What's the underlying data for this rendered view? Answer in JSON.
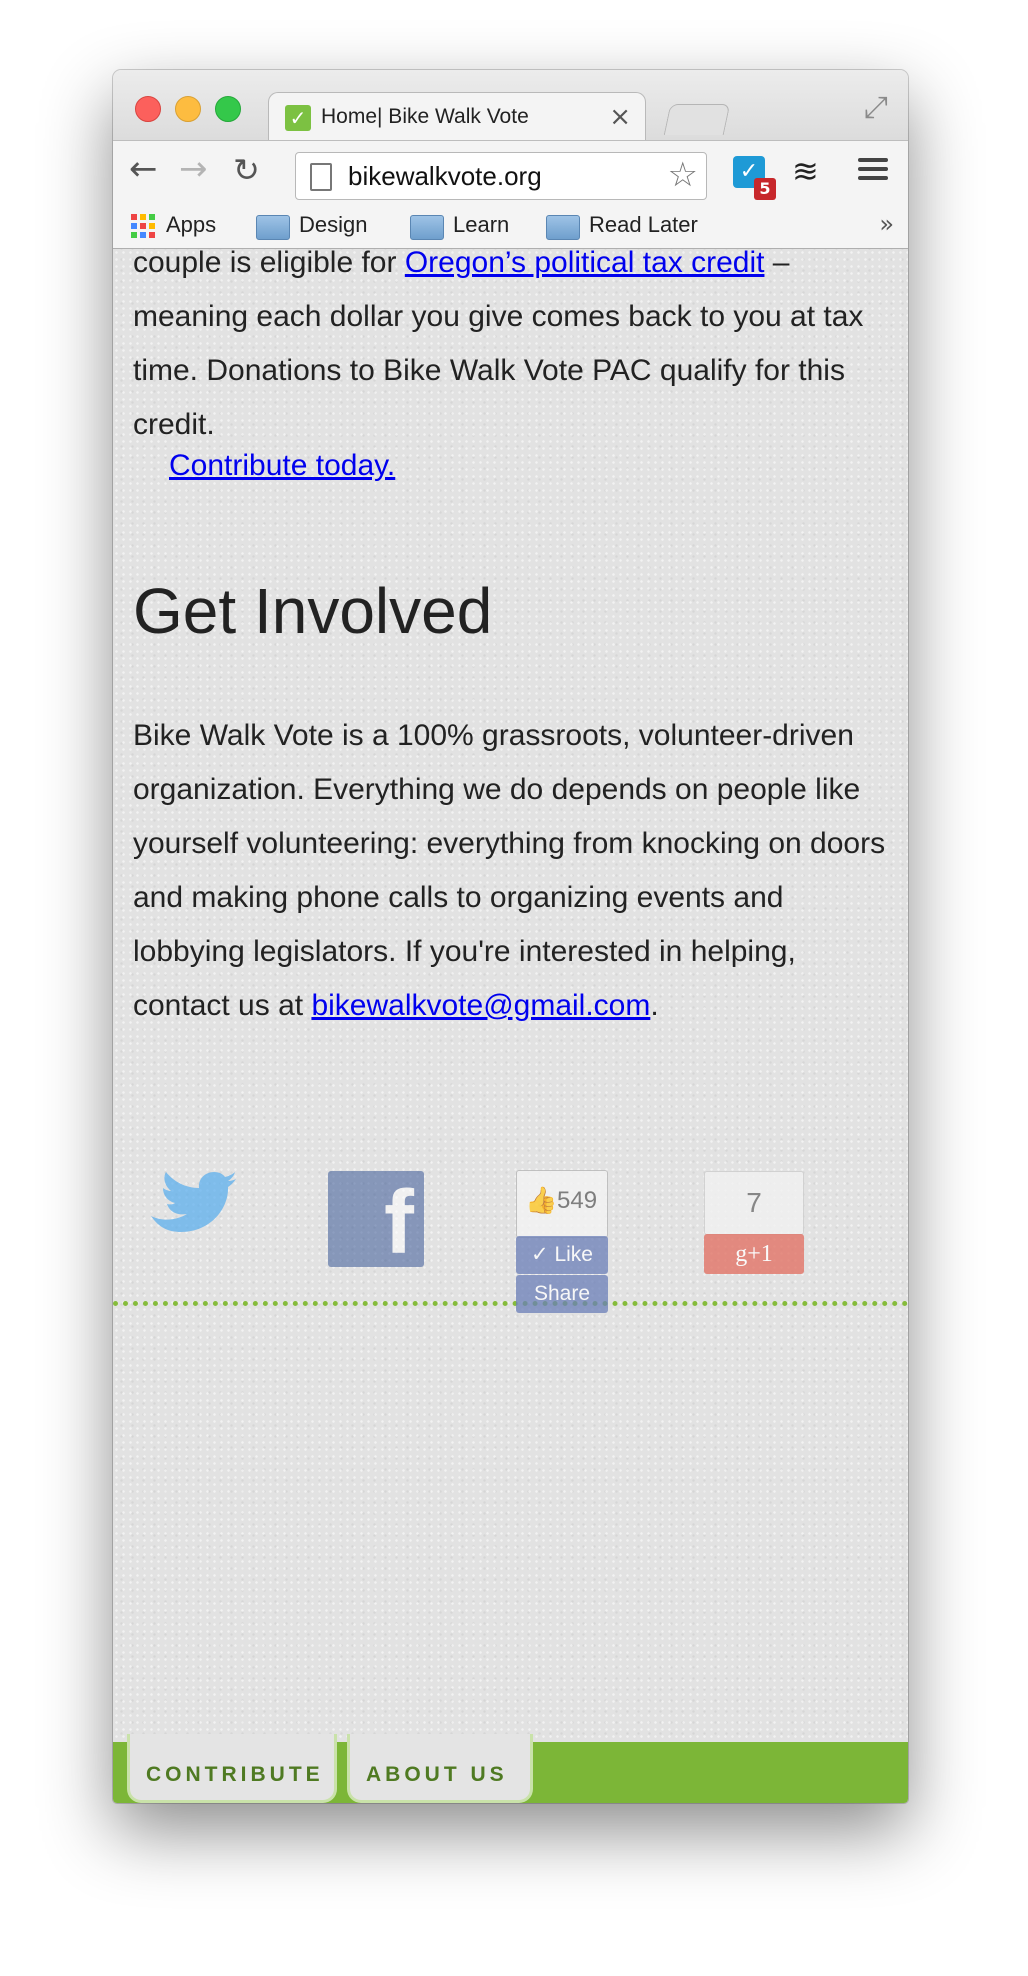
{
  "browser": {
    "tab_title": "Home| Bike Walk Vote",
    "tab_close": "×",
    "url": "bikewalkvote.org",
    "extension_badge": "5",
    "bookmarks": [
      "Apps",
      "Design",
      "Learn",
      "Read Later"
    ],
    "bookmarks_more": "»"
  },
  "page": {
    "intro": {
      "before_link": "couple is eligible for ",
      "link_text": "Oregon’s political tax credit",
      "after_link": " – meaning each dollar you give comes back to you at tax time. Donations to Bike Walk Vote PAC qualify for this credit.",
      "contribute_link": "Contribute today."
    },
    "get_involved": {
      "heading": "Get Involved",
      "body": "Bike Walk Vote is a 100% grassroots, volunteer-driven organization. Everything we do depends on people like yourself volunteering: everything from knocking on doors and making phone calls to organizing events and lobbying legislators. If you're interested in helping, contact us at ",
      "email": "bikewalkvote@gmail.com",
      "end": "."
    },
    "social": {
      "fb_like_count": "549",
      "fb_like_label": "Like",
      "fb_share_label": "Share",
      "gplus_count": "7",
      "gplus_label": "g+1"
    },
    "footer_nav": [
      "CONTRIBUTE",
      "ABOUT US"
    ]
  },
  "colors": {
    "accent_green": "#7cb637",
    "link": "#0000ee",
    "facebook": "#3b5998",
    "twitter": "#55acee",
    "gplus": "#dd4b39"
  },
  "icons": [
    "close-traffic",
    "minimize-traffic",
    "zoom-traffic",
    "back-icon",
    "forward-icon",
    "reload-icon",
    "star-icon",
    "menu-icon",
    "twitter-icon",
    "facebook-icon"
  ]
}
